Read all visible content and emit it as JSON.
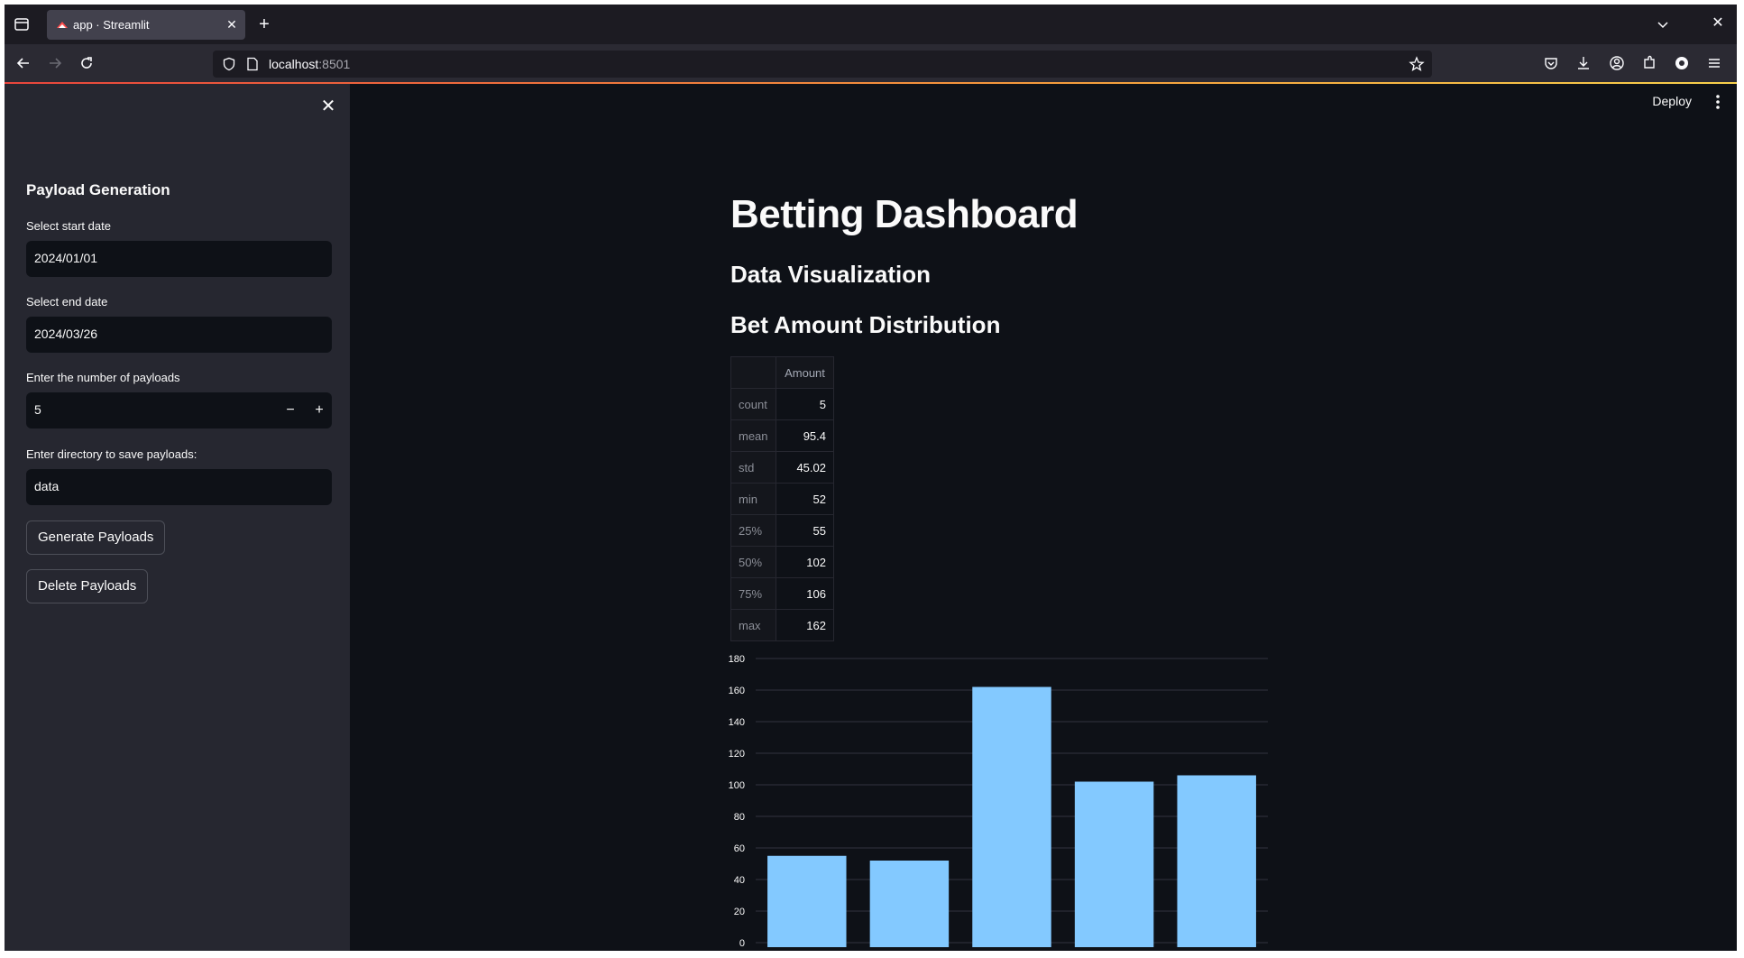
{
  "browser": {
    "tab_title": "app · Streamlit",
    "url_host": "localhost",
    "url_port": ":8501"
  },
  "header": {
    "deploy_label": "Deploy"
  },
  "sidebar": {
    "title": "Payload Generation",
    "start_date_label": "Select start date",
    "start_date_value": "2024/01/01",
    "end_date_label": "Select end date",
    "end_date_value": "2024/03/26",
    "num_payloads_label": "Enter the number of payloads",
    "num_payloads_value": "5",
    "minus_label": "−",
    "plus_label": "+",
    "directory_label": "Enter directory to save payloads:",
    "directory_value": "data",
    "generate_button": "Generate Payloads",
    "delete_button": "Delete Payloads"
  },
  "main": {
    "title": "Betting Dashboard",
    "subtitle": "Data Visualization",
    "section_title": "Bet Amount Distribution",
    "stats_table": {
      "column_header": "Amount",
      "rows": [
        {
          "index": "count",
          "value": "5"
        },
        {
          "index": "mean",
          "value": "95.4"
        },
        {
          "index": "std",
          "value": "45.02"
        },
        {
          "index": "min",
          "value": "52"
        },
        {
          "index": "25%",
          "value": "55"
        },
        {
          "index": "50%",
          "value": "102"
        },
        {
          "index": "75%",
          "value": "106"
        },
        {
          "index": "max",
          "value": "162"
        }
      ]
    }
  },
  "chart_data": {
    "type": "bar",
    "categories": [
      "",
      "",
      "",
      "",
      ""
    ],
    "values": [
      55,
      52,
      162,
      102,
      106
    ],
    "ylim": [
      0,
      180
    ],
    "yticks": [
      0,
      20,
      40,
      60,
      80,
      100,
      120,
      140,
      160,
      180
    ],
    "grid": true,
    "bar_color": "#83c9ff",
    "grid_color": "#31333f"
  },
  "colors": {
    "background": "#0e1117",
    "sidebar": "#262730",
    "text": "#fafafa"
  }
}
